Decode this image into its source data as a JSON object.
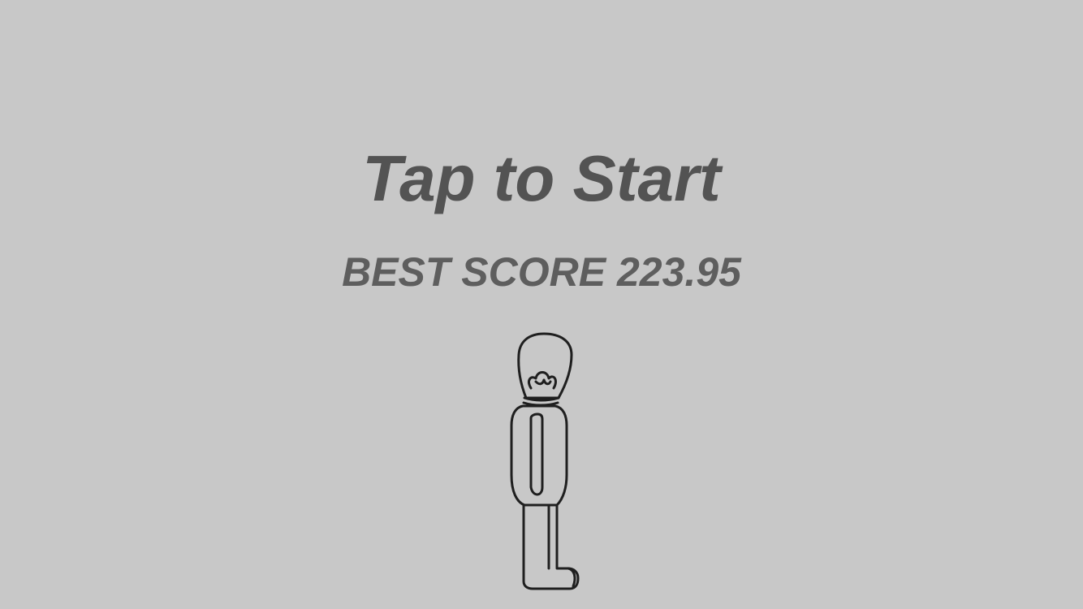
{
  "screen": {
    "title": "Tap to Start",
    "best_score_label": "BEST SCORE",
    "best_score_value": "223.95",
    "best_score_text": "BEST SCORE 223.95"
  },
  "character": {
    "icon": "lightbulb-head-character-icon"
  },
  "colors": {
    "background": "#c8c8c8",
    "title_text": "#535353",
    "score_text": "#5e5e5e",
    "outline": "#1f1f1f"
  }
}
